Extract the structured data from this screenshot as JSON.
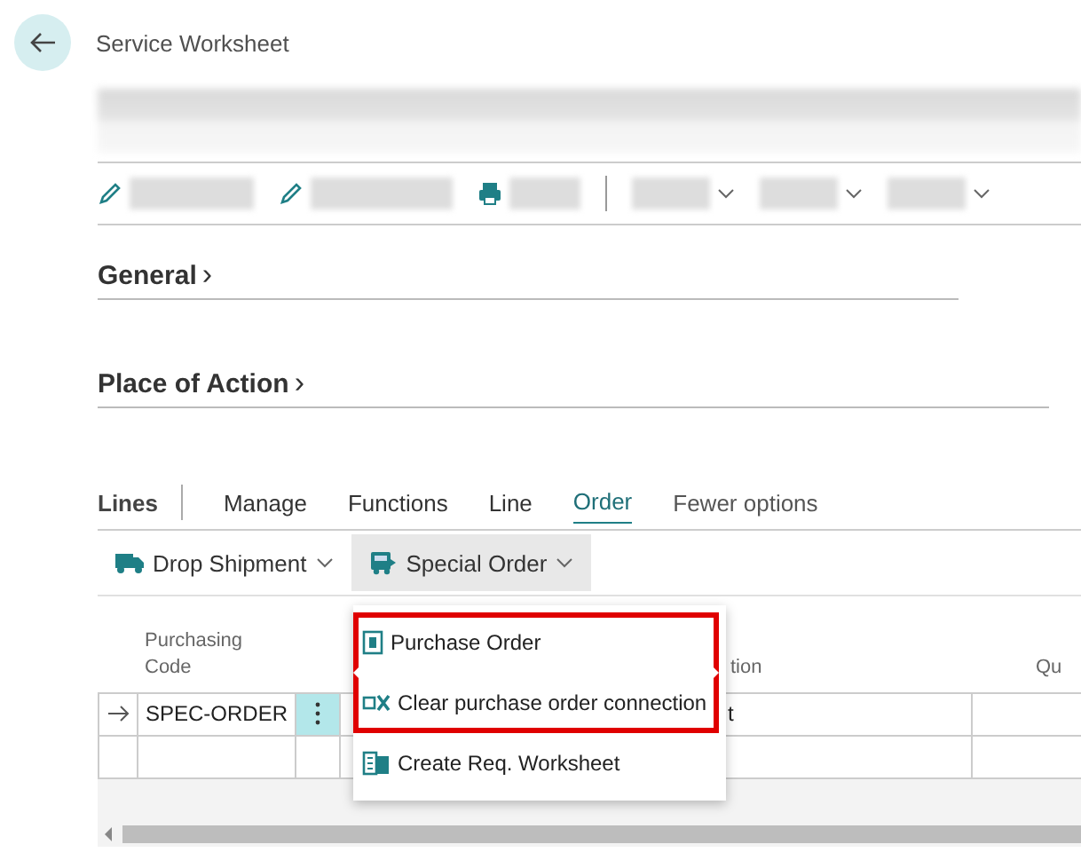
{
  "page": {
    "title": "Service Worksheet"
  },
  "toolbar": [
    {
      "kind": "pencil"
    },
    {
      "kind": "pencil"
    },
    {
      "kind": "printer"
    },
    {
      "kind": "divider"
    },
    {
      "kind": "dropdown"
    },
    {
      "kind": "dropdown"
    },
    {
      "kind": "dropdown"
    }
  ],
  "sections": [
    {
      "title": "General",
      "chevron": "›"
    },
    {
      "title": "Place of Action",
      "chevron": "›"
    }
  ],
  "lines": {
    "title": "Lines",
    "tabs": [
      {
        "label": "Manage",
        "selected": false
      },
      {
        "label": "Functions",
        "selected": false
      },
      {
        "label": "Line",
        "selected": false
      },
      {
        "label": "Order",
        "selected": true
      },
      {
        "label": "Fewer options",
        "selected": false
      }
    ],
    "actions": [
      {
        "label": "Drop Shipment",
        "open": false
      },
      {
        "label": "Special Order",
        "open": true
      }
    ],
    "menu": [
      {
        "label": "Purchase Order",
        "highlighted": true
      },
      {
        "label": "Clear purchase order connection",
        "highlighted": true
      },
      {
        "label": "Create Req. Worksheet",
        "highlighted": false
      }
    ],
    "columns": [
      "",
      "Purchasing Code",
      "",
      "",
      "",
      "tion",
      "Qu"
    ],
    "rows": [
      {
        "current": true,
        "cells": [
          "SPEC-ORDER",
          "",
          "",
          "",
          "t",
          ""
        ]
      },
      {
        "current": false,
        "cells": [
          "",
          "",
          "",
          "",
          "",
          ""
        ]
      }
    ]
  }
}
